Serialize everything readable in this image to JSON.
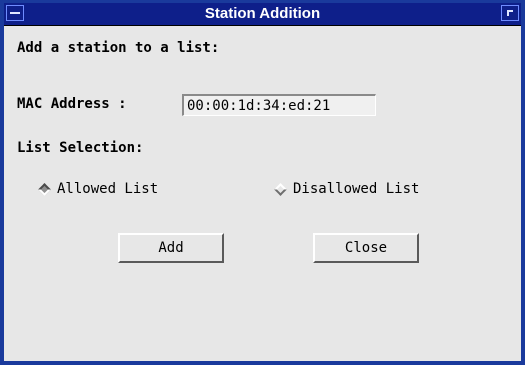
{
  "window": {
    "title": "Station Addition"
  },
  "form": {
    "heading": "Add a station to a list:",
    "mac_label": "MAC Address :",
    "mac_value": "00:00:1d:34:ed:21",
    "list_selection_label": "List Selection:",
    "radios": [
      {
        "label": "Allowed List",
        "selected": true
      },
      {
        "label": "Disallowed List",
        "selected": false
      }
    ]
  },
  "buttons": {
    "add": "Add",
    "close": "Close"
  },
  "colors": {
    "titlebar": "#0e1f8a",
    "frame": "#1a3a9c",
    "background": "#e7e7e7"
  },
  "icons": {
    "window_menu": "window-menu-icon",
    "maximize": "maximize-icon"
  }
}
